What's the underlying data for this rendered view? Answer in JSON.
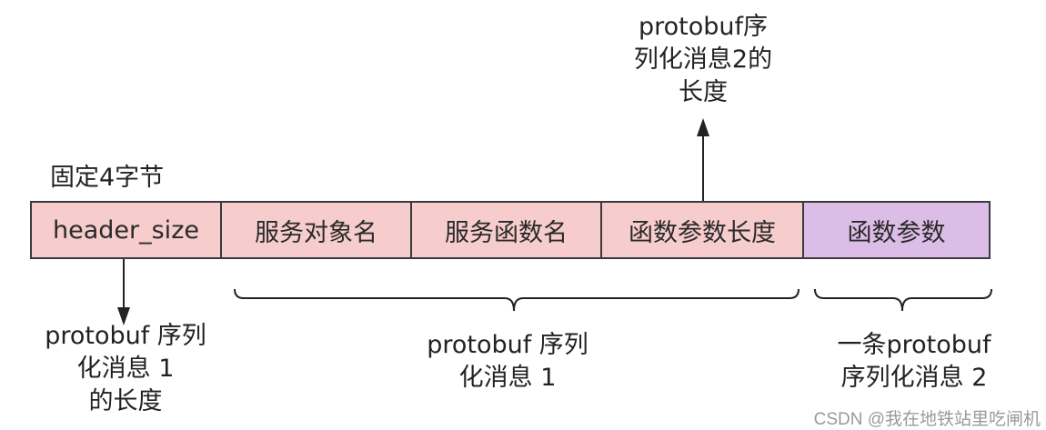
{
  "fixed_label": "固定4字节",
  "cells": [
    "header_size",
    "服务对象名",
    "服务函数名",
    "函数参数长度",
    "函数参数"
  ],
  "top_annotation": [
    "protobuf序",
    "列化消息2的",
    "长度"
  ],
  "left_annotation": [
    "protobuf 序列",
    "化消息 1",
    "的长度"
  ],
  "middle_annotation": [
    "protobuf 序列",
    "化消息 1"
  ],
  "right_annotation": [
    "一条protobuf",
    "序列化消息 2"
  ],
  "watermark": "CSDN @我在地铁站里吃闸机",
  "colors": {
    "cell_fill": "#f6cccc",
    "accent_fill": "#dcbde8",
    "border": "#3a3a3a"
  }
}
